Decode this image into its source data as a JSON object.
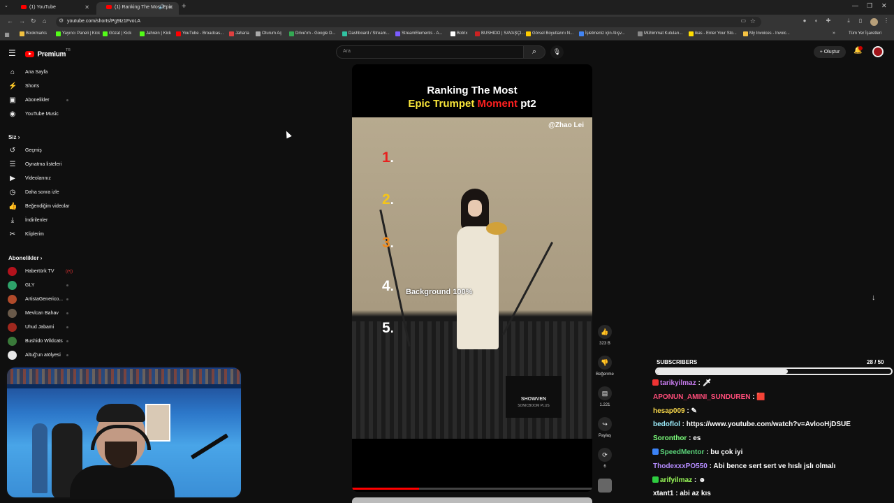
{
  "browser": {
    "tabs": [
      {
        "title": "(1) YouTube"
      },
      {
        "title": "(1) Ranking The Most Epic"
      }
    ],
    "url": "youtube.com/shorts/Pg9tz1FvoLA",
    "bookmarks": [
      {
        "label": "Bookmarks",
        "color": "#f0c040"
      },
      {
        "label": "Yayıncı Paneli | Kick",
        "color": "#53fc18"
      },
      {
        "label": "Gözat | Kick",
        "color": "#53fc18"
      },
      {
        "label": "Jahrein | Kick",
        "color": "#53fc18"
      },
      {
        "label": "YouTube - Broadcas...",
        "color": "#ff0000"
      },
      {
        "label": "Jaharia",
        "color": "#e04040"
      },
      {
        "label": "Oturum Aç",
        "color": "#aaaaaa"
      },
      {
        "label": "Drive'ım - Google D...",
        "color": "#34a853"
      },
      {
        "label": "Dashboard / Stream...",
        "color": "#31c3a2"
      },
      {
        "label": "StreamElements - A...",
        "color": "#7b5cff"
      },
      {
        "label": "Botrix",
        "color": "#ffffff"
      },
      {
        "label": "BUSHIDO | SAVAŞÇI...",
        "color": "#cc2222"
      },
      {
        "label": "Görsel Boyutlarını N...",
        "color": "#ffcc00"
      },
      {
        "label": "İşletmeniz için Alışv...",
        "color": "#4285f4"
      },
      {
        "label": "Mühimmat Kutuları...",
        "color": "#888888"
      },
      {
        "label": "ikas - Enter Your Sto...",
        "color": "#ffdd00"
      },
      {
        "label": "My Invoices - Invoic...",
        "color": "#f6c343"
      }
    ],
    "all_bookmarks": "Tüm Yer İşaretleri"
  },
  "youtube": {
    "brand": "Premium",
    "brand_sup": "TR",
    "search_placeholder": "Ara",
    "create_label": "Oluştur",
    "notification_count": "1",
    "sidebar": {
      "main": [
        {
          "label": "Ana Sayfa",
          "icon": "home-icon",
          "glyph": "⌂"
        },
        {
          "label": "Shorts",
          "icon": "shorts-icon",
          "glyph": "⚡"
        },
        {
          "label": "Abonelikler",
          "icon": "subscriptions-icon",
          "glyph": "▣"
        },
        {
          "label": "YouTube Music",
          "icon": "music-icon",
          "glyph": "◉"
        }
      ],
      "you_heading": "Siz",
      "you": [
        {
          "label": "Geçmiş",
          "icon": "history-icon",
          "glyph": "↺"
        },
        {
          "label": "Oynatma listeleri",
          "icon": "playlists-icon",
          "glyph": "☰"
        },
        {
          "label": "Videolarınız",
          "icon": "your-videos-icon",
          "glyph": "▶"
        },
        {
          "label": "Daha sonra izle",
          "icon": "watch-later-icon",
          "glyph": "◷"
        },
        {
          "label": "Beğendiğim videolar",
          "icon": "liked-icon",
          "glyph": "👍"
        },
        {
          "label": "İndirilenler",
          "icon": "downloads-icon",
          "glyph": "⤓"
        },
        {
          "label": "Kliplerim",
          "icon": "clips-icon",
          "glyph": "✂"
        }
      ],
      "subs_heading": "Abonelikler",
      "subscriptions": [
        {
          "label": "Habertürk TV",
          "color": "#b3121c",
          "live": true
        },
        {
          "label": "GLY",
          "color": "#2ea36a",
          "live": false
        },
        {
          "label": "ArtistaGenerico...",
          "color": "#b04a2a",
          "live": false
        },
        {
          "label": "Mevlcan Bahav",
          "color": "#6a5a4a",
          "live": false
        },
        {
          "label": "Uhud Jabami",
          "color": "#a0281e",
          "live": false
        },
        {
          "label": "Bushido Wildcats",
          "color": "#3a7a3a",
          "live": false
        },
        {
          "label": "Altuğ'un atölyesi",
          "color": "#e8e8e8",
          "live": false
        }
      ]
    },
    "short": {
      "title_line1": "Ranking The Most",
      "title_line2_yellow": "Epic Trumpet",
      "title_line2_red": "Moment",
      "title_line2_white": "pt2",
      "handle": "@Zhao Lei",
      "ranks": [
        {
          "n": "1",
          "color": "#e8201e"
        },
        {
          "n": "2",
          "color": "#f5c518"
        },
        {
          "n": "3",
          "color": "#f08a1c"
        },
        {
          "n": "4",
          "color": "#ffffff"
        },
        {
          "n": "5",
          "color": "#ffffff"
        }
      ],
      "rank_dot": ".",
      "rank4_label": "Background 100%",
      "stage_brand": "SHOWVEN",
      "stage_brand_sub": "SONICBOOM PLUS",
      "progress": 0.28
    },
    "actions": {
      "like_count": "323 B",
      "dislike_label": "Beğenme",
      "comment_count": "1.221",
      "share_label": "Paylaş",
      "remix_count": "6"
    }
  },
  "overlay": {
    "subscribers_label": "SUBSCRIBERS",
    "subscribers_count": "28 / 50",
    "subscribers_fraction": 0.56,
    "chat": [
      {
        "user": "tarikyilmaz",
        "color": "#c97cf0",
        "badge": "#e33",
        "text": "🗡"
      },
      {
        "user": "APONUN_AMINI_SUNDUREN",
        "color": "#ff4d7a",
        "badge": "",
        "text": "🟥"
      },
      {
        "user": "hesap009",
        "color": "#f5d54a",
        "badge": "",
        "text": "✎"
      },
      {
        "user": "bedoflol",
        "color": "#9ef0ff",
        "badge": "",
        "text": "https://www.youtube.com/watch?v=AvlooHjDSUE"
      },
      {
        "user": "Soronthor",
        "color": "#7cff7c",
        "badge": "",
        "text": "es"
      },
      {
        "user": "SpeedMentor",
        "color": "#5bd37a",
        "badge": "#3b82f6",
        "text": "bu çok iyi"
      },
      {
        "user": "ThodexxxPO550",
        "color": "#b58cff",
        "badge": "",
        "text": "Abi bence sert sert ve hıslı jslı olmalı"
      },
      {
        "user": "arifyilmaz",
        "color": "#9cff5a",
        "badge": "#2ecc40",
        "text": "☻"
      },
      {
        "user": "xtant1",
        "color": "#ffffff",
        "badge": "",
        "text": "abi az kıs"
      }
    ],
    "chat_separator": ":"
  }
}
